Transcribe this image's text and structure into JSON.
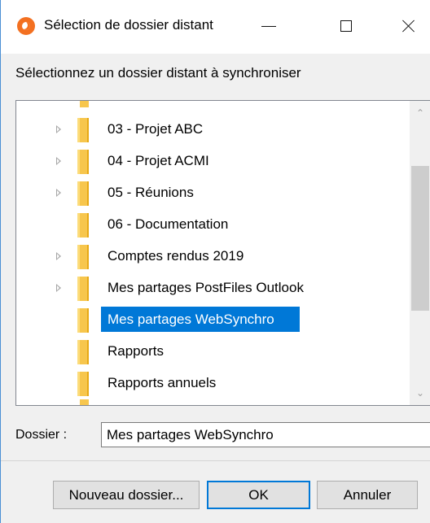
{
  "window": {
    "title": "Sélection de dossier distant"
  },
  "prompt": "Sélectionnez un dossier distant à synchroniser",
  "tree": {
    "items": [
      {
        "label": "03 - Projet ABC",
        "expandable": true,
        "selected": false
      },
      {
        "label": "04 - Projet ACMI",
        "expandable": true,
        "selected": false
      },
      {
        "label": "05 - Réunions",
        "expandable": true,
        "selected": false
      },
      {
        "label": "06 - Documentation",
        "expandable": false,
        "selected": false
      },
      {
        "label": "Comptes rendus 2019",
        "expandable": true,
        "selected": false
      },
      {
        "label": "Mes partages PostFiles Outlook",
        "expandable": true,
        "selected": false
      },
      {
        "label": "Mes partages WebSynchro",
        "expandable": false,
        "selected": true
      },
      {
        "label": "Rapports",
        "expandable": false,
        "selected": false
      },
      {
        "label": "Rapports annuels",
        "expandable": false,
        "selected": false
      }
    ]
  },
  "folder_field": {
    "label": "Dossier :",
    "value": "Mes partages WebSynchro"
  },
  "buttons": {
    "new_folder": "Nouveau dossier...",
    "ok": "OK",
    "cancel": "Annuler"
  },
  "colors": {
    "selection": "#0078d7",
    "folder": "#f7c64d",
    "app_icon": "#f37021"
  },
  "icons": {
    "app": "websynchro-app-icon",
    "minimize": "minimize-icon",
    "maximize": "maximize-icon",
    "close": "close-icon",
    "folder": "folder-icon",
    "expander": "chevron-right-icon"
  }
}
